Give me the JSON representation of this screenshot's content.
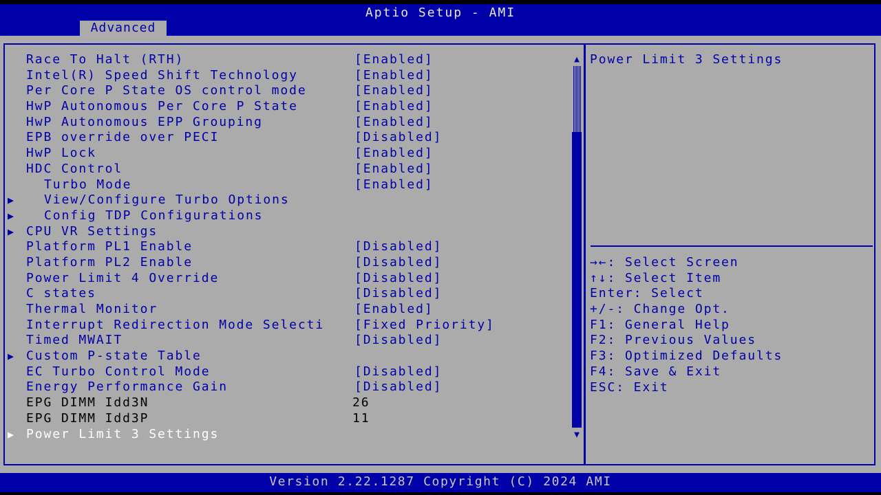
{
  "header": {
    "title": "Aptio Setup - AMI",
    "active_tab": "Advanced"
  },
  "menu": [
    {
      "label": "Race To Halt (RTH)",
      "value": "[Enabled]"
    },
    {
      "label": "Intel(R) Speed Shift Technology",
      "value": "[Enabled]"
    },
    {
      "label": "Per Core P State OS control mode",
      "value": "[Enabled]"
    },
    {
      "label": "HwP Autonomous Per Core P State",
      "value": "[Enabled]"
    },
    {
      "label": "HwP Autonomous EPP Grouping",
      "value": "[Enabled]"
    },
    {
      "label": "EPB override over PECI",
      "value": "[Disabled]"
    },
    {
      "label": "HwP Lock",
      "value": "[Enabled]"
    },
    {
      "label": "HDC Control",
      "value": "[Enabled]"
    },
    {
      "label": "Turbo Mode",
      "value": "[Enabled]"
    },
    {
      "label": "View/Configure Turbo Options",
      "arrow": "▶"
    },
    {
      "label": "Config TDP Configurations",
      "arrow": "▶"
    },
    {
      "label": "CPU VR Settings",
      "arrow": "▶"
    },
    {
      "label": "Platform PL1 Enable",
      "value": "[Disabled]"
    },
    {
      "label": "Platform PL2 Enable",
      "value": "[Disabled]"
    },
    {
      "label": "Power Limit 4 Override",
      "value": "[Disabled]"
    },
    {
      "label": "C states",
      "value": "[Disabled]"
    },
    {
      "label": "Thermal Monitor",
      "value": "[Enabled]"
    },
    {
      "label": "Interrupt Redirection Mode Selecti",
      "value": "[Fixed Priority]"
    },
    {
      "label": "Timed MWAIT",
      "value": "[Disabled]"
    },
    {
      "label": "Custom P-state Table",
      "arrow": "▶"
    },
    {
      "label": "EC Turbo Control Mode",
      "value": "[Disabled]"
    },
    {
      "label": "Energy Performance Gain",
      "value": "[Disabled]"
    },
    {
      "label": "EPG DIMM Idd3N",
      "value": "26"
    },
    {
      "label": "EPG DIMM Idd3P",
      "value": "11"
    },
    {
      "label": "Power Limit 3 Settings",
      "arrow": "▶"
    }
  ],
  "scrollbar": {
    "up": "▲",
    "down": "▼"
  },
  "help": {
    "title": "Power Limit 3 Settings",
    "keys": [
      "→←: Select Screen",
      "↑↓: Select Item",
      "Enter: Select",
      "+/-: Change Opt.",
      "F1: General Help",
      "F2: Previous Values",
      "F3: Optimized Defaults",
      "F4: Save & Exit",
      "ESC: Exit"
    ]
  },
  "footer": {
    "version": "Version 2.22.1287 Copyright (C) 2024 AMI"
  },
  "colors": {
    "background": "#ababab",
    "accent": "#0000a8",
    "selected_text": "#ffffff",
    "info_text": "#000000"
  }
}
